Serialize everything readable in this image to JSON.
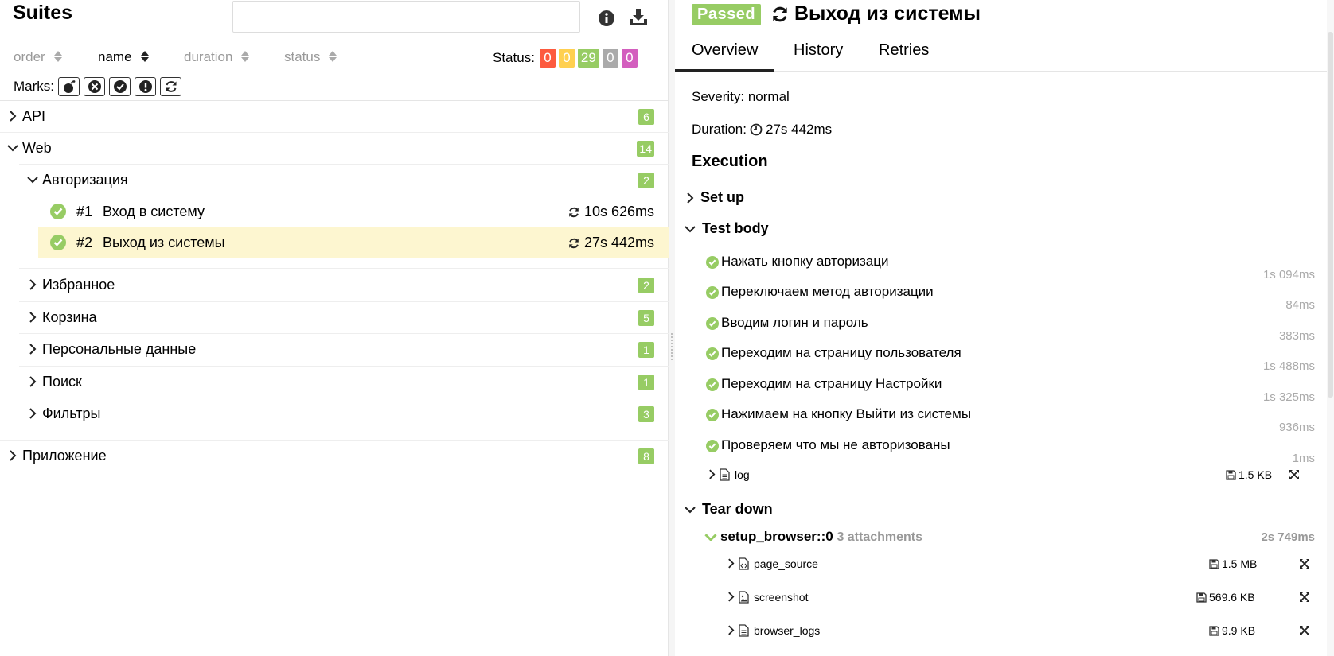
{
  "left": {
    "title": "Suites",
    "search": {
      "value": "",
      "placeholder": ""
    },
    "info_icon": "info-icon",
    "download_icon": "download-icon",
    "sorters": [
      {
        "label": "order",
        "active": false
      },
      {
        "label": "name",
        "active": true
      },
      {
        "label": "duration",
        "active": false
      },
      {
        "label": "status",
        "active": false
      }
    ],
    "status_filter": {
      "label": "Status:",
      "counts": [
        {
          "value": "0",
          "color": "#fd5a3e",
          "status": "failed"
        },
        {
          "value": "0",
          "color": "#ffd050",
          "status": "broken"
        },
        {
          "value": "29",
          "color": "#97cc64",
          "status": "passed"
        },
        {
          "value": "0",
          "color": "#aaaaaa",
          "status": "skipped"
        },
        {
          "value": "0",
          "color": "#d35ebe",
          "status": "unknown"
        }
      ]
    },
    "marks": {
      "label": "Marks:",
      "items": [
        "flaky-icon",
        "new-failed-icon",
        "new-passed-icon",
        "new-broken-icon",
        "retries-icon"
      ]
    },
    "tree": {
      "api": {
        "name": "API",
        "count": "6"
      },
      "web": {
        "name": "Web",
        "count": "14"
      },
      "auth": {
        "name": "Авторизация",
        "count": "2"
      },
      "tests": [
        {
          "num": "#1",
          "name": "Вход в систему",
          "duration": "10s 626ms",
          "selected": false
        },
        {
          "num": "#2",
          "name": "Выход из системы",
          "duration": "27s 442ms",
          "selected": true
        }
      ],
      "groups": [
        {
          "name": "Избранное",
          "count": "2"
        },
        {
          "name": "Корзина",
          "count": "5"
        },
        {
          "name": "Персональные данные",
          "count": "1"
        },
        {
          "name": "Поиск",
          "count": "1"
        },
        {
          "name": "Фильтры",
          "count": "3"
        }
      ],
      "app": {
        "name": "Приложение",
        "count": "8"
      }
    }
  },
  "right": {
    "status": "Passed",
    "title": "Выход из системы",
    "tabs": [
      "Overview",
      "History",
      "Retries"
    ],
    "severity": "Severity: normal",
    "duration_label": "Duration:",
    "duration": "27s 442ms",
    "execution_title": "Execution",
    "setup_label": "Set up",
    "test_body_label": "Test body",
    "steps": [
      {
        "name": "Нажать кнопку авторизаци",
        "duration": "1s 094ms"
      },
      {
        "name": "Переключаем метод авторизации",
        "duration": "84ms"
      },
      {
        "name": "Вводим логин и пароль",
        "duration": "383ms"
      },
      {
        "name": "Переходим на страницу пользователя",
        "duration": "1s 488ms"
      },
      {
        "name": "Переходим на страницу Настройки",
        "duration": "1s 325ms"
      },
      {
        "name": "Нажимаем на кнопку Выйти из системы",
        "duration": "936ms"
      },
      {
        "name": "Проверяем что мы не авторизованы",
        "duration": "1ms"
      }
    ],
    "log_attachment": {
      "name": "log",
      "size": "1.5 KB"
    },
    "teardown_label": "Tear down",
    "fixture": {
      "name": "setup_browser::0",
      "attachments": "3 attachments",
      "duration": "2s 749ms"
    },
    "fixture_attachments": [
      {
        "name": "page_source",
        "size": "1.5 MB",
        "icon": "code-file-icon"
      },
      {
        "name": "screenshot",
        "size": "569.6 KB",
        "icon": "image-file-icon"
      },
      {
        "name": "browser_logs",
        "size": "9.9 KB",
        "icon": "text-file-icon"
      }
    ]
  }
}
